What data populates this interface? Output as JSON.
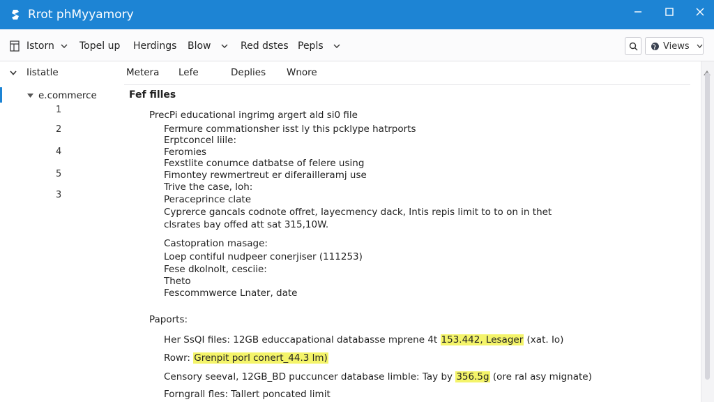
{
  "window": {
    "title": "Rrot phMyyamory",
    "app_icon": "tools-icon",
    "controls": [
      "minimize-icon",
      "maximize-icon",
      "close-icon"
    ]
  },
  "toolbar": {
    "items": [
      {
        "label": "Istorn",
        "icon": "table-icon",
        "dropdown": true
      },
      {
        "label": "Topel up"
      },
      {
        "label": "Herdings"
      },
      {
        "label": "Blow",
        "dropdown": true
      },
      {
        "label": "Red dstes"
      },
      {
        "label": "Pepls",
        "dropdown": true
      }
    ],
    "search_icon": "search-icon",
    "views": {
      "label": "Views",
      "icon": "globe-icon"
    }
  },
  "sidebar": {
    "root": {
      "label": "Iistatle",
      "expanded": true
    },
    "db": {
      "label": "e.commerce",
      "expanded": true
    },
    "items": [
      "1",
      "2",
      "4",
      "5",
      "3"
    ]
  },
  "main": {
    "columns": [
      "Metera",
      "Lefe",
      "Deplies",
      "Wnore"
    ],
    "section_title": "Fef filles",
    "lines": [
      "PrecPi educational ingrimg argert ald si0 file",
      "Fermure commationsher isst ly this pcklype hatrports",
      "Erptconcel Iiile:",
      "Feromies",
      "Fexstlite conumce datbatse of felere using",
      "Fimontey rewmertreut er diferailleramj use",
      "Trive the case, loh:",
      "Peraceprince clate",
      "Cyprerce gancals codnote offret, Iayecmency dack, Intis repis limit to to on in thet",
      "clsrates bay offed att sat 315,10W.",
      "Castopration masage:",
      "Loep contiful nudpeer conerjiser (111253)",
      "Fese dkolnolt, cesciie:",
      "Theto",
      "Fescommwerce Lnater, date",
      "Paports:"
    ],
    "rows": [
      {
        "pre": "Her SsQI files: 12GB educcapational databasse mprene 4t ",
        "hl": "153.442, Lesager",
        "post": " (xat. Io)"
      },
      {
        "pre": "Rowr: ",
        "hl": "Grenpit porl conert_44.3 lm)",
        "post": ""
      },
      {
        "pre": "Censory seeval, 12GB_BD puccuncer database limble: Tay by ",
        "hl": "356.5g",
        "post": " (ore ral asy mignate)"
      },
      {
        "pre": "Forngrall fles: Tallert poncated limit",
        "hl": "",
        "post": ""
      }
    ]
  },
  "colors": {
    "titlebar": "#1d84d4",
    "highlight": "#f4f46a",
    "accent": "#1d84d4"
  }
}
